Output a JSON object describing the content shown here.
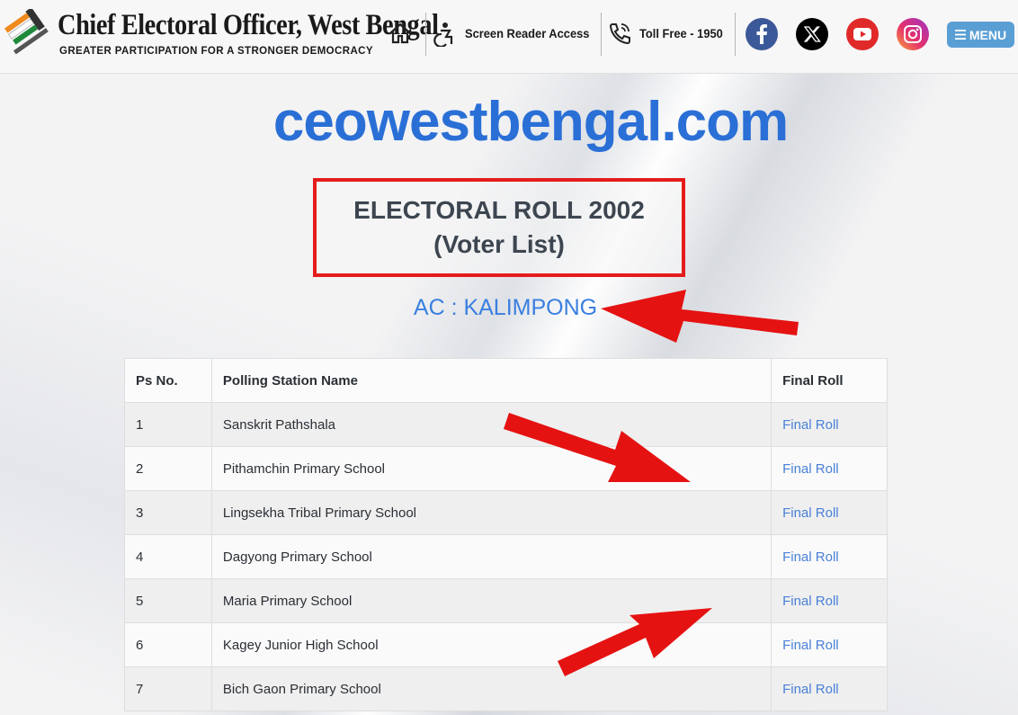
{
  "header": {
    "site_title": "Chief Electoral Officer, West Bengal",
    "tagline": "GREATER PARTICIPATION FOR A STRONGER DEMOCRACY",
    "screen_reader": "Screen Reader Access",
    "toll_free": "Toll Free - 1950",
    "menu_label": "MENU",
    "icons": [
      "home-icon",
      "accessibility-icon",
      "phone-icon",
      "facebook-icon",
      "x-icon",
      "youtube-icon",
      "instagram-icon",
      "hamburger-icon"
    ]
  },
  "main": {
    "domain": "ceowestbengal.com",
    "title_line1": "ELECTORAL ROLL 2002",
    "title_line2": "(Voter List)",
    "ac_label": "AC : KALIMPONG"
  },
  "table": {
    "headers": [
      "Ps No.",
      "Polling Station Name",
      "Final Roll"
    ],
    "rows": [
      {
        "no": "1",
        "name": "Sanskrit Pathshala",
        "link": "Final Roll"
      },
      {
        "no": "2",
        "name": "Pithamchin Primary School",
        "link": "Final Roll"
      },
      {
        "no": "3",
        "name": "Lingsekha Tribal Primary School",
        "link": "Final Roll"
      },
      {
        "no": "4",
        "name": "Dagyong Primary School",
        "link": "Final Roll"
      },
      {
        "no": "5",
        "name": "Maria Primary School",
        "link": "Final Roll"
      },
      {
        "no": "6",
        "name": "Kagey Junior High School",
        "link": "Final Roll"
      },
      {
        "no": "7",
        "name": "Bich Gaon Primary School",
        "link": "Final Roll"
      }
    ]
  },
  "colors": {
    "accent_blue": "#2a6fd6",
    "link_blue": "#4a80d8",
    "highlight_red": "#e51c1c",
    "menu_bg": "#5a9fd4",
    "facebook": "#3b5998",
    "youtube": "#e02a2a",
    "x": "#000000"
  }
}
